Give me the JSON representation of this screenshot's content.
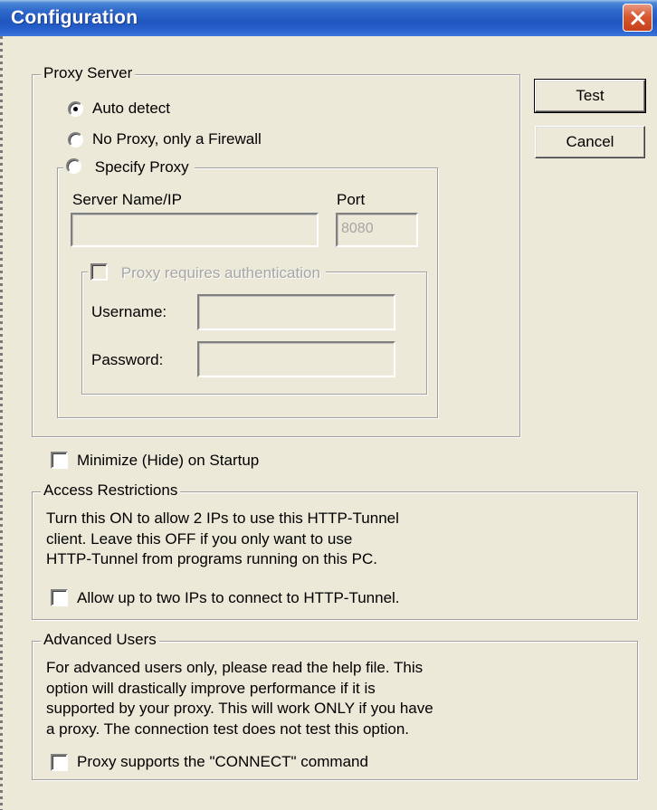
{
  "window": {
    "title": "Configuration"
  },
  "buttons": {
    "test": "Test",
    "cancel": "Cancel"
  },
  "proxy_server": {
    "legend": "Proxy Server",
    "options": [
      {
        "label": "Auto detect",
        "selected": true
      },
      {
        "label": "No Proxy, only a Firewall",
        "selected": false
      },
      {
        "label": "Specify Proxy",
        "selected": false
      }
    ],
    "server_label": "Server Name/IP",
    "server_value": "",
    "port_label": "Port",
    "port_value": "8080",
    "auth": {
      "label": "Proxy requires authentication",
      "checked": false,
      "enabled": false,
      "username_label": "Username:",
      "username_value": "",
      "password_label": "Password:",
      "password_value": ""
    }
  },
  "minimize": {
    "label": "Minimize (Hide) on Startup",
    "checked": false
  },
  "access_restrictions": {
    "legend": "Access Restrictions",
    "lines": [
      "Turn this ON to allow 2 IPs to use this HTTP-Tunnel",
      "client. Leave this OFF if you only want to use",
      "HTTP-Tunnel from programs running on this PC."
    ],
    "checkbox_label": "Allow up to two IPs to connect to HTTP-Tunnel.",
    "checked": false
  },
  "advanced_users": {
    "legend": "Advanced Users",
    "lines": [
      "For advanced users only, please read the help file. This",
      "option will drastically improve performance if it is",
      "supported by your proxy. This will work ONLY if you have",
      "a proxy. The connection test does not test this option."
    ],
    "checkbox_label": "Proxy supports the \"CONNECT\" command",
    "checked": false
  },
  "icons": {
    "close": "close-icon"
  },
  "colors": {
    "titlebar": "#2e69cc",
    "close": "#d8582f",
    "face": "#ece9d8"
  }
}
